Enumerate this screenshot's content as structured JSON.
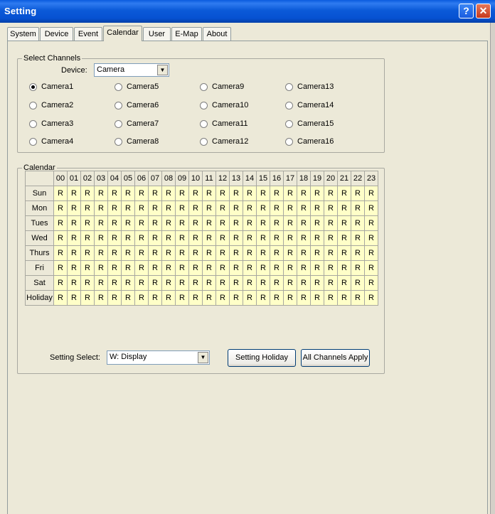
{
  "window": {
    "title": "Setting",
    "help_label": "?",
    "close_label": "✕"
  },
  "tabs": [
    "System",
    "Device",
    "Event",
    "Calendar",
    "User",
    "E-Map",
    "About"
  ],
  "active_tab": "Calendar",
  "channels": {
    "group_label": "Select Channels",
    "device_label": "Device:",
    "device_value": "Camera",
    "cameras": [
      "Camera1",
      "Camera2",
      "Camera3",
      "Camera4",
      "Camera5",
      "Camera6",
      "Camera7",
      "Camera8",
      "Camera9",
      "Camera10",
      "Camera11",
      "Camera12",
      "Camera13",
      "Camera14",
      "Camera15",
      "Camera16"
    ],
    "selected": "Camera1"
  },
  "calendar": {
    "group_label": "Calendar",
    "hours": [
      "00",
      "01",
      "02",
      "03",
      "04",
      "05",
      "06",
      "07",
      "08",
      "09",
      "10",
      "11",
      "12",
      "13",
      "14",
      "15",
      "16",
      "17",
      "18",
      "19",
      "20",
      "21",
      "22",
      "23"
    ],
    "days": [
      "Sun",
      "Mon",
      "Tues",
      "Wed",
      "Thurs",
      "Fri",
      "Sat",
      "Holiday"
    ],
    "cell_value": "R",
    "cell_color": "#FFFFC8",
    "setting_select_label": "Setting Select:",
    "setting_select_value": "W: Display",
    "setting_holiday_label": "Setting Holiday",
    "all_channels_apply_label": "All Channels Apply"
  },
  "colors": {
    "titlebar": "#0A5BDE",
    "background": "#ECE9D8"
  }
}
